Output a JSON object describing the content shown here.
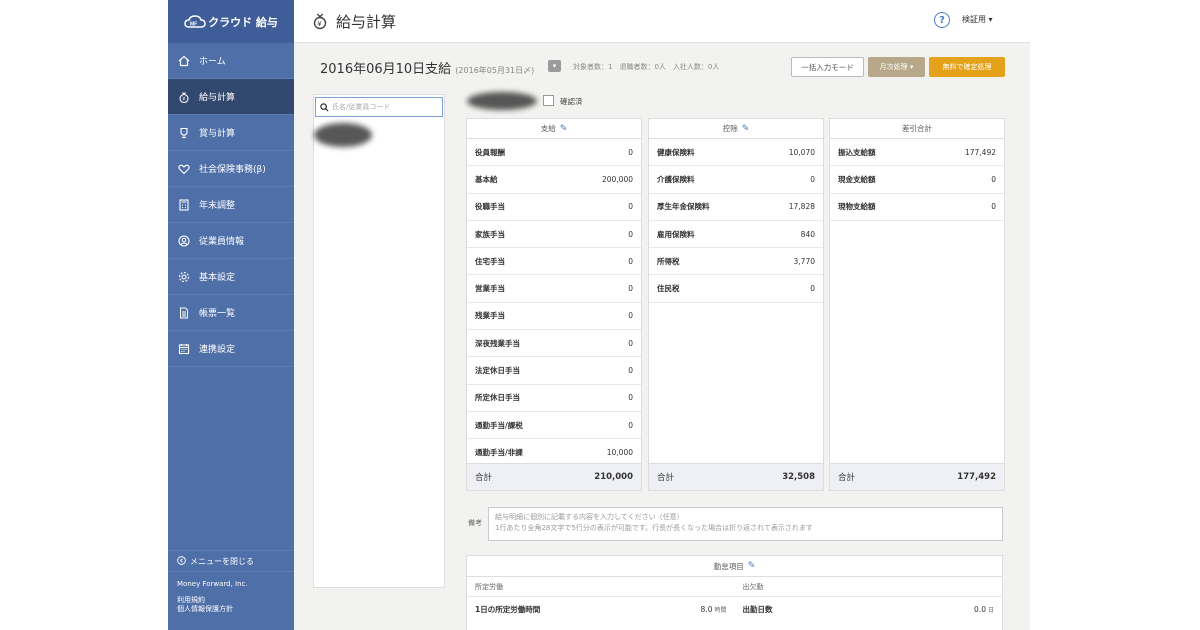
{
  "app": {
    "logo_text": "クラウド 給与"
  },
  "sidebar": {
    "items": [
      {
        "label": "ホーム",
        "icon": "home-icon"
      },
      {
        "label": "給与計算",
        "icon": "money-bag-icon",
        "active": true
      },
      {
        "label": "賞与計算",
        "icon": "trophy-icon"
      },
      {
        "label": "社会保険事務(β)",
        "icon": "heart-icon"
      },
      {
        "label": "年末調整",
        "icon": "calculator-icon"
      },
      {
        "label": "従業員情報",
        "icon": "person-icon"
      },
      {
        "label": "基本設定",
        "icon": "gear-icon"
      },
      {
        "label": "帳票一覧",
        "icon": "document-icon"
      },
      {
        "label": "連携設定",
        "icon": "calendar-icon"
      }
    ],
    "close_menu": "メニューを閉じる",
    "company": "Money Forward, Inc.",
    "terms": "利用規約",
    "privacy": "個人情報保護方針"
  },
  "header": {
    "title": "給与計算",
    "user": "検証用 ▾"
  },
  "toolbar": {
    "payday": "2016年06月10日支給",
    "closing": "(2016年05月31日〆)",
    "counts": "対象者数：1　退職者数：0人　入社人数：0人",
    "bulk_mode": "一括入力モード",
    "monthly": "月次処理 ▾",
    "confirm": "無料で確定処理"
  },
  "search": {
    "placeholder": "氏名/従業員コード"
  },
  "confirmed_label": "確認済",
  "payments": {
    "title": "支給",
    "rows": [
      {
        "label": "役員報酬",
        "value": "0"
      },
      {
        "label": "基本給",
        "value": "200,000"
      },
      {
        "label": "役職手当",
        "value": "0"
      },
      {
        "label": "家族手当",
        "value": "0"
      },
      {
        "label": "住宅手当",
        "value": "0"
      },
      {
        "label": "営業手当",
        "value": "0"
      },
      {
        "label": "残業手当",
        "value": "0"
      },
      {
        "label": "深夜残業手当",
        "value": "0"
      },
      {
        "label": "法定休日手当",
        "value": "0"
      },
      {
        "label": "所定休日手当",
        "value": "0"
      },
      {
        "label": "通勤手当/課税",
        "value": "0"
      },
      {
        "label": "通勤手当/非課",
        "value": "10,000"
      }
    ],
    "total_label": "合計",
    "total": "210,000"
  },
  "deductions": {
    "title": "控除",
    "rows": [
      {
        "label": "健康保険料",
        "value": "10,070"
      },
      {
        "label": "介護保険料",
        "value": "0"
      },
      {
        "label": "厚生年金保険料",
        "value": "17,828"
      },
      {
        "label": "雇用保険料",
        "value": "840"
      },
      {
        "label": "所得税",
        "value": "3,770"
      },
      {
        "label": "住民税",
        "value": "0"
      }
    ],
    "total_label": "合計",
    "total": "32,508"
  },
  "net": {
    "title": "差引合計",
    "rows": [
      {
        "label": "振込支給額",
        "value": "177,492"
      },
      {
        "label": "現金支給額",
        "value": "0"
      },
      {
        "label": "現物支給額",
        "value": "0"
      }
    ],
    "total_label": "合計",
    "total": "177,492"
  },
  "remarks": {
    "label": "備考",
    "placeholder_line1": "給与明細に個別に記載する内容を入力してください（任意）",
    "placeholder_line2": "1行あたり全角28文字で5行分の表示が可能です。行長が長くなった場合は折り返されて表示されます"
  },
  "attendance": {
    "title": "勤怠項目",
    "left_title": "所定労働",
    "right_title": "出欠勤",
    "left_row": {
      "label": "1日の所定労働時間",
      "value": "8.0",
      "unit": "時間"
    },
    "right_row": {
      "label": "出勤日数",
      "value": "0.0",
      "unit": "日"
    }
  }
}
